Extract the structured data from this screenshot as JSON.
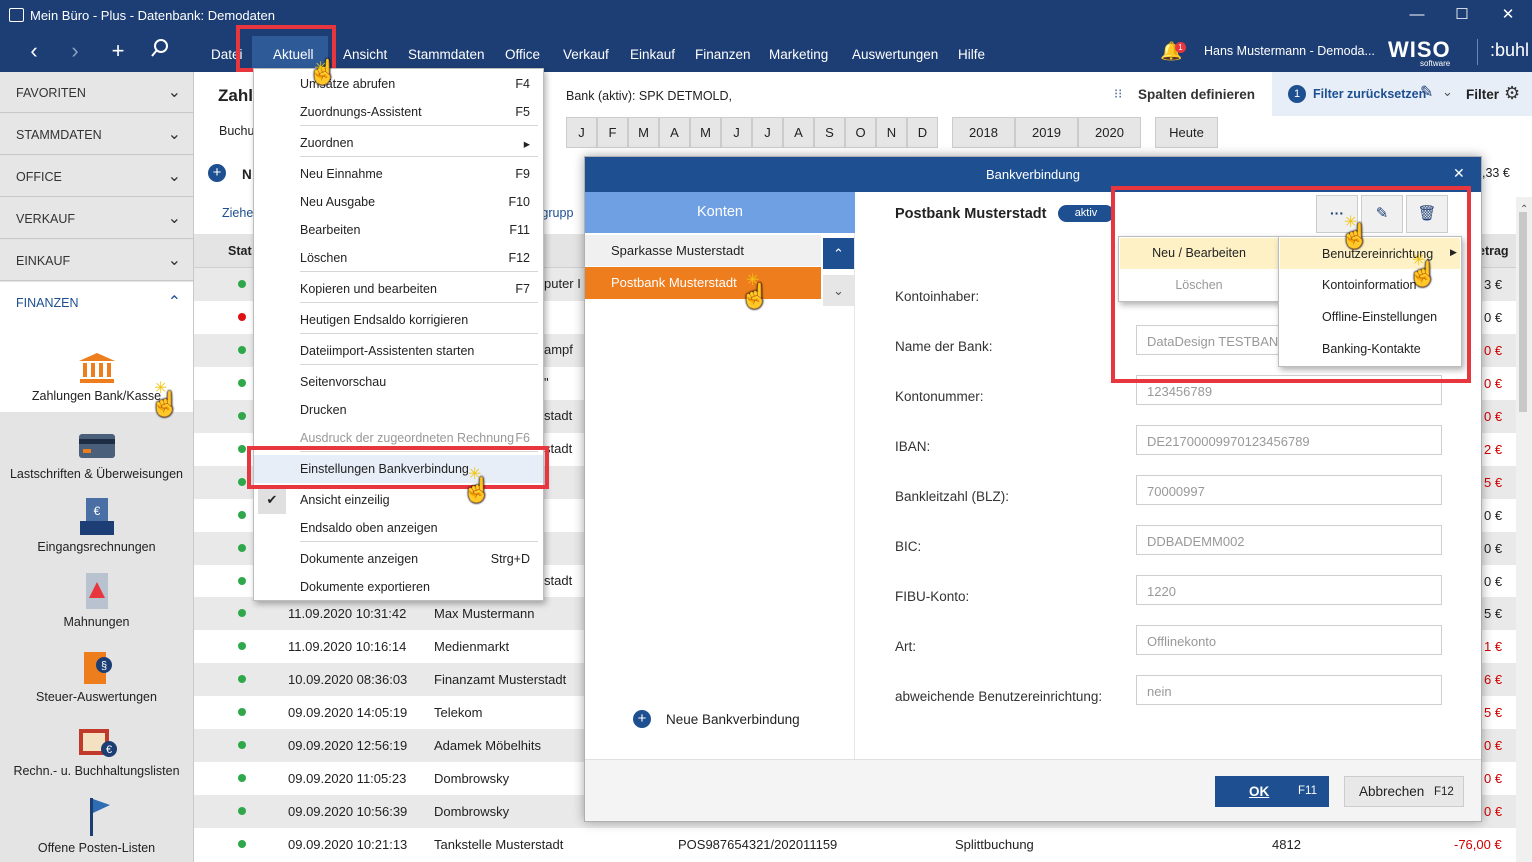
{
  "titlebar": {
    "title": "Mein Büro - Plus - Datenbank: Demodaten",
    "min": "—",
    "max": "☐",
    "close": "✕"
  },
  "topbar": {
    "menus": [
      "Datei",
      "Aktuell",
      "Ansicht",
      "Stammdaten",
      "Office",
      "Verkauf",
      "Einkauf",
      "Finanzen",
      "Marketing",
      "Auswertungen",
      "Hilfe"
    ],
    "user": "Hans Mustermann - Demoda...",
    "badge": "1",
    "brand1": "WISO",
    "brand1_sub": "software",
    "brand2": ":buhl"
  },
  "sidebar": {
    "sections": [
      "FAVORITEN",
      "STAMMDATEN",
      "OFFICE",
      "VERKAUF",
      "EINKAUF",
      "FINANZEN"
    ],
    "items": [
      "Zahlungen Bank/Kasse",
      "Lastschriften & Überweisungen",
      "Eingangsrechnungen",
      "Mahnungen",
      "Steuer-Auswertungen",
      "Rechn.- u. Buchhaltungslisten",
      "Offene Posten-Listen"
    ]
  },
  "main": {
    "title": "Zahlu",
    "buch": "Buchu",
    "n": "N",
    "ziehe": "Ziehe",
    "grupp": "u grupp",
    "stat": "Stat",
    "betrag": "etrag",
    "total": ",33 €",
    "bank_label": "Bank (aktiv): SPK DETMOLD,",
    "spalten": "Spalten definieren",
    "filter_reset": "Filter zurücksetzen",
    "filter_reset_num": "1",
    "filter": "Filter",
    "months": [
      "J",
      "F",
      "M",
      "A",
      "M",
      "J",
      "J",
      "A",
      "S",
      "O",
      "N",
      "D"
    ],
    "years": [
      "2018",
      "2019",
      "2020"
    ],
    "heute": "Heute",
    "peek_texts": [
      "puter I",
      "ampf",
      "\"",
      "stadt",
      "stadt",
      "stadt"
    ]
  },
  "table": {
    "upper_amounts": [
      "3 €",
      "0 €",
      "0 €",
      "0 €",
      "0 €",
      "2 €",
      "5 €",
      "0 €",
      "0 €",
      "0 €"
    ],
    "rows": [
      {
        "date": "11.09.2020 10:31:42",
        "name": "Max Mustermann",
        "amount": "5 €"
      },
      {
        "date": "11.09.2020 10:16:14",
        "name": "Medienmarkt",
        "amount": "1 €"
      },
      {
        "date": "10.09.2020 08:36:03",
        "name": "Finanzamt Musterstadt",
        "amount": "6 €"
      },
      {
        "date": "09.09.2020 14:05:19",
        "name": "Telekom",
        "amount": "5 €"
      },
      {
        "date": "09.09.2020 12:56:19",
        "name": "Adamek Möbelhits",
        "amount": "0 €"
      },
      {
        "date": "09.09.2020 11:05:23",
        "name": "Dombrowsky",
        "amount": "0 €"
      },
      {
        "date": "09.09.2020 10:56:39",
        "name": "Dombrowsky",
        "amount": "0 €"
      },
      {
        "date": "09.09.2020 10:21:13",
        "name": "Tankstelle Musterstadt",
        "ref": "POS987654321/202011159",
        "type": "Splittbuchung",
        "acct": "4812",
        "amount": "-76,00 €"
      }
    ]
  },
  "dropdown": {
    "items": [
      {
        "label": "Umsätze abrufen",
        "key": "F4"
      },
      {
        "label": "Zuordnungs-Assistent",
        "key": "F5"
      },
      {
        "label": "Zuordnen",
        "key": "▸"
      },
      {
        "label": "Neu Einnahme",
        "key": "F9"
      },
      {
        "label": "Neu Ausgabe",
        "key": "F10"
      },
      {
        "label": "Bearbeiten",
        "key": "F11"
      },
      {
        "label": "Löschen",
        "key": "F12"
      },
      {
        "label": "Kopieren und bearbeiten",
        "key": "F7"
      },
      {
        "label": "Heutigen Endsaldo korrigieren",
        "key": ""
      },
      {
        "label": "Dateiimport-Assistenten starten",
        "key": ""
      },
      {
        "label": "Seitenvorschau",
        "key": ""
      },
      {
        "label": "Drucken",
        "key": ""
      },
      {
        "label": "Ausdruck der zugeordneten Rechnung",
        "key": "F6"
      },
      {
        "label": "Einstellungen Bankverbindung",
        "key": ""
      },
      {
        "label": "Ansicht einzeilig",
        "key": ""
      },
      {
        "label": "Endsaldo oben anzeigen",
        "key": ""
      },
      {
        "label": "Dokumente anzeigen",
        "key": "Strg+D"
      },
      {
        "label": "Dokumente exportieren",
        "key": ""
      }
    ]
  },
  "modal": {
    "title": "Bankverbindung",
    "close": "✕",
    "konten": "Konten",
    "accounts": [
      "Sparkasse Musterstadt",
      "Postbank Musterstadt"
    ],
    "new_conn": "Neue Bankverbindung",
    "bank_title": "Postbank Musterstadt",
    "status": "aktiv",
    "fields": [
      {
        "label": "Kontoinhaber:",
        "value": ""
      },
      {
        "label": "Name der Bank:",
        "value": "DataDesign TESTBANK"
      },
      {
        "label": "Kontonummer:",
        "value": "123456789"
      },
      {
        "label": "IBAN:",
        "value": "DE21700009970123456789"
      },
      {
        "label": "Bankleitzahl (BLZ):",
        "value": "70000997"
      },
      {
        "label": "BIC:",
        "value": "DDBADEMM002"
      },
      {
        "label": "FIBU-Konto:",
        "value": "1220"
      },
      {
        "label": "Art:",
        "value": "Offlinekonto"
      },
      {
        "label": "abweichende Benutzereinrichtung:",
        "value": "nein"
      }
    ],
    "ok": "OK",
    "ok_key": "F11",
    "cancel": "Abbrechen",
    "cancel_key": "F12",
    "more": "···"
  },
  "submenu1": {
    "items": [
      "Neu / Bearbeiten",
      "Löschen"
    ]
  },
  "submenu2": {
    "items": [
      "Benutzereinrichtung",
      "Kontoinformation",
      "Offline-Einstellungen",
      "Banking-Kontakte"
    ]
  },
  "colors": {
    "navy": "#1d3e74",
    "blue": "#1d4f91",
    "accent": "#e8363e",
    "orange": "#ee7d1e",
    "hilite": "#fff1c6"
  }
}
